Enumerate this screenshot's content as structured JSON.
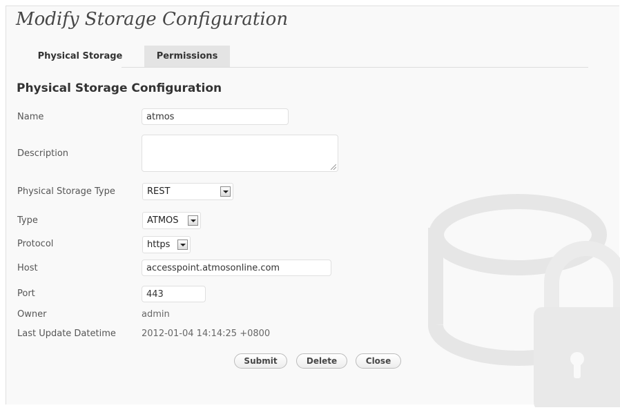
{
  "page": {
    "title": "Modify Storage Configuration"
  },
  "tabs": [
    {
      "label": "Physical Storage",
      "active": true
    },
    {
      "label": "Permissions",
      "active": false
    }
  ],
  "section": {
    "title": "Physical Storage Configuration"
  },
  "form": {
    "name": {
      "label": "Name",
      "value": "atmos"
    },
    "description": {
      "label": "Description",
      "value": ""
    },
    "physical_storage_type": {
      "label": "Physical Storage Type",
      "value": "REST"
    },
    "type": {
      "label": "Type",
      "value": "ATMOS"
    },
    "protocol": {
      "label": "Protocol",
      "value": "https"
    },
    "host": {
      "label": "Host",
      "value": "accesspoint.atmosonline.com"
    },
    "port": {
      "label": "Port",
      "value": "443"
    },
    "owner": {
      "label": "Owner",
      "value": "admin"
    },
    "last_update": {
      "label": "Last Update Datetime",
      "value": "2012-01-04 14:14:25 +0800"
    }
  },
  "buttons": {
    "submit": "Submit",
    "delete": "Delete",
    "close": "Close"
  },
  "icons": {
    "background": "storage-lock-icon",
    "dropdown": "chevron-down-icon",
    "resize": "resize-grip-icon"
  },
  "colors": {
    "panel_bg": "#f9f9f9",
    "inactive_tab_bg": "#e4e4e4",
    "graphic": "#e6e6e6"
  }
}
